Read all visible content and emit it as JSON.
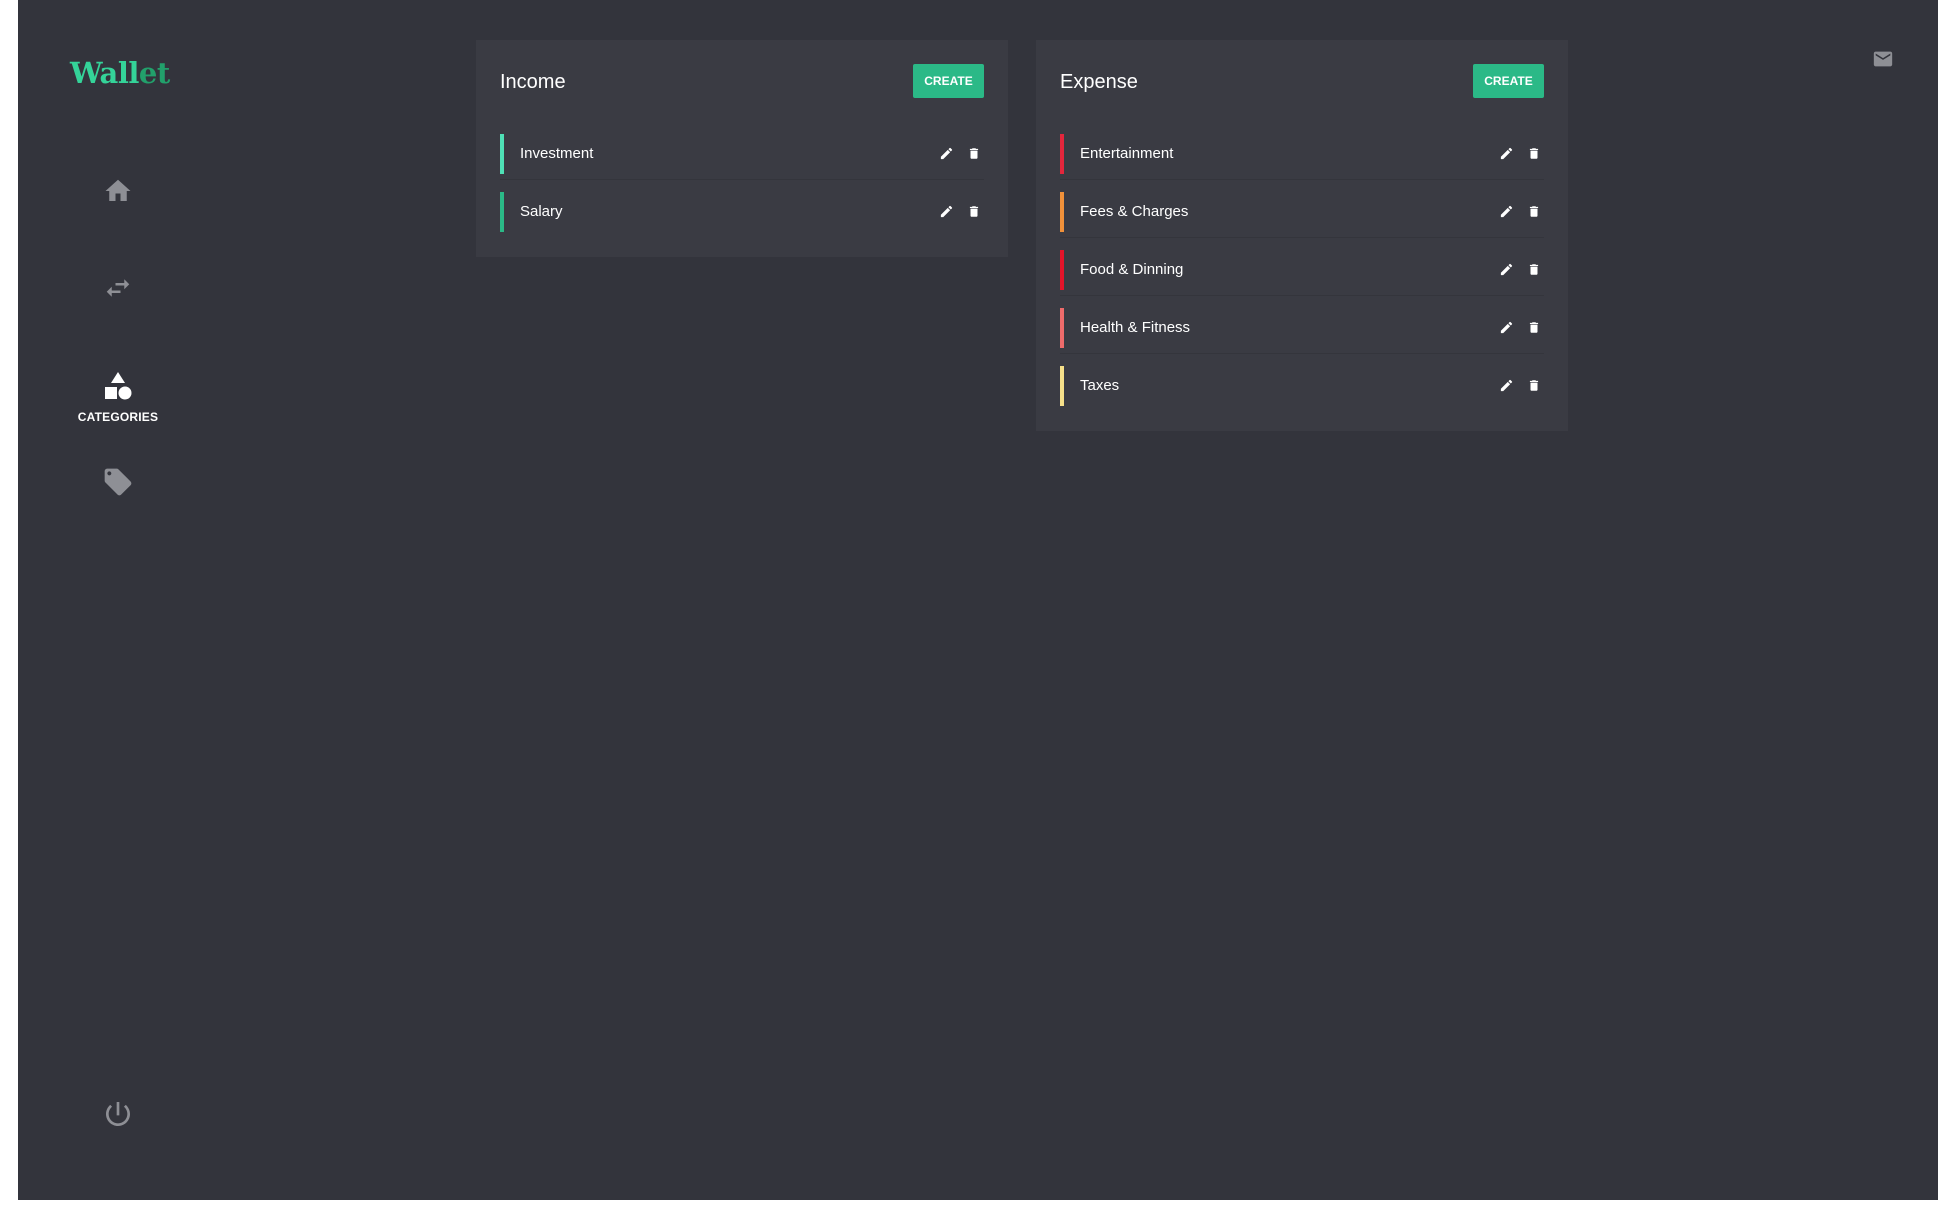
{
  "app": {
    "logo_part1": "Wall",
    "logo_part2": "et"
  },
  "sidebar": {
    "items": [
      {
        "icon": "home-icon",
        "label": ""
      },
      {
        "icon": "transfer-icon",
        "label": ""
      },
      {
        "icon": "categories-icon",
        "label": "CATEGORIES",
        "active": true
      },
      {
        "icon": "tag-icon",
        "label": ""
      }
    ],
    "logout_icon": "power-icon"
  },
  "header": {
    "mail_icon": "mail-icon"
  },
  "income": {
    "title": "Income",
    "create_label": "CREATE",
    "items": [
      {
        "name": "Investment",
        "color": "#4fe0b6"
      },
      {
        "name": "Salary",
        "color": "#2bb987"
      }
    ]
  },
  "expense": {
    "title": "Expense",
    "create_label": "CREATE",
    "items": [
      {
        "name": "Entertainment",
        "color": "#e3263c"
      },
      {
        "name": "Fees & Charges",
        "color": "#f0913a"
      },
      {
        "name": "Food & Dinning",
        "color": "#e3142a"
      },
      {
        "name": "Health & Fitness",
        "color": "#ee6b6b"
      },
      {
        "name": "Taxes",
        "color": "#f6e08a"
      }
    ]
  },
  "colors": {
    "background": "#33343c",
    "card": "#3a3b43",
    "accent": "#2bb987",
    "icon_muted": "#8e8f95"
  }
}
